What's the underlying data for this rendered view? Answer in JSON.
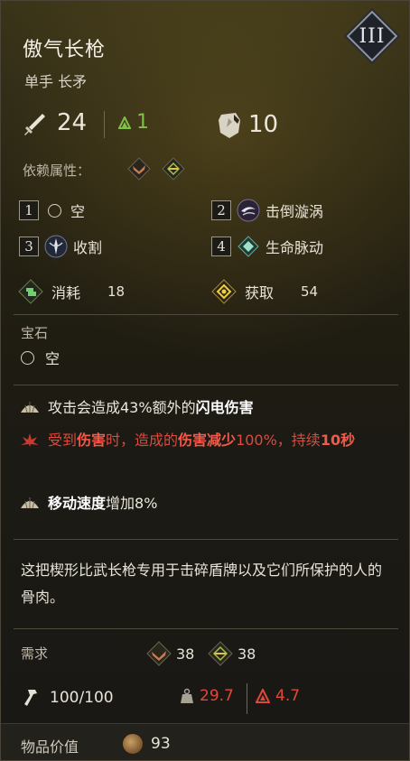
{
  "item": {
    "tier": "III",
    "name": "傲气长枪",
    "type": "单手 长矛",
    "attack": "24",
    "level_req": "1",
    "defense": "10"
  },
  "dependency": {
    "label": "依赖属性："
  },
  "slots": [
    {
      "num": "1",
      "label": "空"
    },
    {
      "num": "2",
      "label": "击倒漩涡"
    },
    {
      "num": "3",
      "label": "收割"
    },
    {
      "num": "4",
      "label": "生命脉动"
    }
  ],
  "resources": {
    "consume_label": "消耗",
    "consume_value": "18",
    "gain_label": "获取",
    "gain_value": "54"
  },
  "gem": {
    "label": "宝石",
    "slot": "空"
  },
  "affixes": {
    "a1_pre": "攻击会造成43%额外的",
    "a1_bold": "闪电伤害",
    "a2_p1": "受到",
    "a2_b1": "伤害",
    "a2_p2": "时，造成的",
    "a2_b2": "伤害减少",
    "a2_p3": "100%，持续",
    "a2_b3": "10秒",
    "a3_bold": "移动速度",
    "a3_post": "增加8%"
  },
  "flavor": "这把楔形比武长枪专用于击碎盾牌以及它们所保护的人的骨肉。",
  "requirements": {
    "label": "需求",
    "str": "38",
    "dex": "38"
  },
  "durability": "100/100",
  "weight": "29.7",
  "strength_req": "4.7",
  "value": {
    "label": "物品价值",
    "amount": "93"
  },
  "colors": {
    "accent_green": "#7fbf4a",
    "warning_red": "#e0483c",
    "gold": "#d8b23c"
  }
}
